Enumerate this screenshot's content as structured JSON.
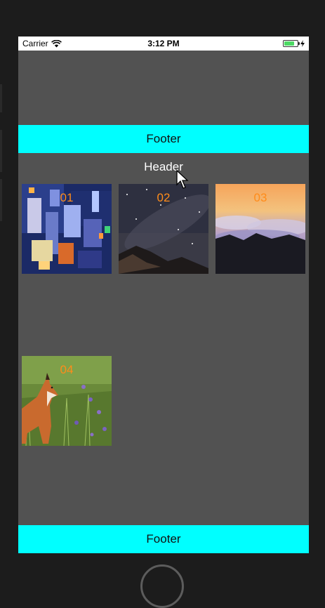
{
  "status_bar": {
    "carrier": "Carrier",
    "time": "3:12 PM",
    "battery_level": 0.75
  },
  "top_footer": {
    "label": "Footer"
  },
  "header": {
    "label": "Header"
  },
  "grid_items": [
    {
      "number": "01",
      "image": "city-at-night-aerial-photo"
    },
    {
      "number": "02",
      "image": "starry-night-sky-over-mountains-photo"
    },
    {
      "number": "03",
      "image": "sunset-above-clouds-photo"
    },
    {
      "number": "04",
      "image": "fox-in-meadow-photo"
    }
  ],
  "bottom_footer": {
    "label": "Footer"
  },
  "colors": {
    "bar": "#00ffff",
    "screen_background": "#525252",
    "number_text": "#ff8c1a",
    "header_text": "#ffffff"
  }
}
